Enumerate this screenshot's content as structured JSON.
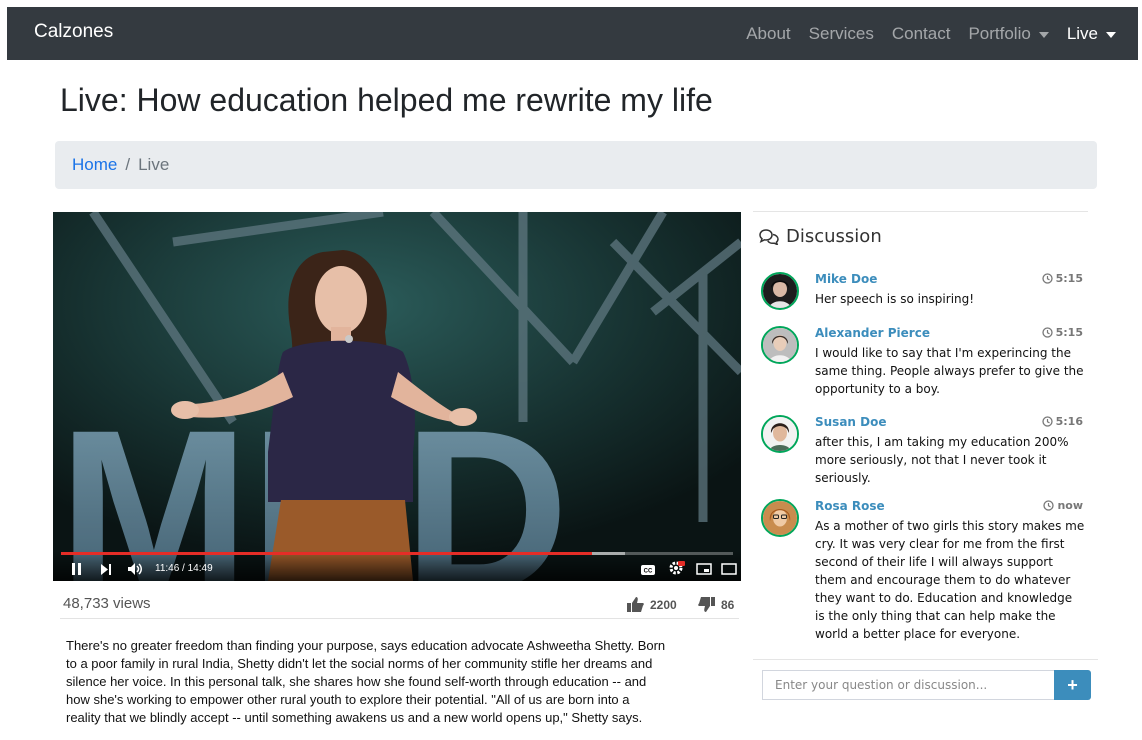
{
  "navbar": {
    "brand": "Calzones",
    "links": [
      {
        "label": "About",
        "active": false,
        "dropdown": false
      },
      {
        "label": "Services",
        "active": false,
        "dropdown": false
      },
      {
        "label": "Contact",
        "active": false,
        "dropdown": false
      },
      {
        "label": "Portfolio",
        "active": false,
        "dropdown": true
      },
      {
        "label": "Live",
        "active": true,
        "dropdown": true
      }
    ]
  },
  "page": {
    "title": "Live: How education helped me rewrite my life"
  },
  "breadcrumb": {
    "home": "Home",
    "separator": "/",
    "current": "Live"
  },
  "video": {
    "current_time": "11:46",
    "duration": "14:49",
    "time_display": "11:46 / 14:49",
    "progress_fraction": 0.79,
    "buffered_fraction": 0.84,
    "backdrop_letters": "MED",
    "views": "48,733 views",
    "likes": "2200",
    "dislikes": "86",
    "description": "There's no greater freedom than finding your purpose, says education advocate Ashweetha Shetty. Born to a poor family in rural India, Shetty didn't let the social norms of her community stifle her dreams and silence her voice. In this personal talk, she shares how she found self-worth through education -- and how she's working to empower other rural youth to explore their potential. \"All of us are born into a reality that we blindly accept -- until something awakens us and a new world opens up,\" Shetty says."
  },
  "discussion": {
    "title": "Discussion",
    "messages": [
      {
        "name": "Mike Doe",
        "time": "5:15",
        "text": "Her speech is so inspiring!"
      },
      {
        "name": "Alexander Pierce",
        "time": "5:15",
        "text": "I would like to say that I'm experincing the same thing. People always prefer to give the opportunity to a boy."
      },
      {
        "name": "Susan Doe",
        "time": "5:16",
        "text": "after this, I am taking my education 200% more seriously, not that I never took it seriously."
      },
      {
        "name": "Rosa Rose",
        "time": "now",
        "text": "As a mother of two girls this story makes me cry. It was very clear for me from the first second of their life I will always support them and encourage them to do whatever they want to do. Education and knowledge is the only thing that can help make the world a better place for everyone."
      }
    ],
    "input_placeholder": "Enter your question or discussion...",
    "submit_label": "+"
  },
  "colors": {
    "navbar_bg": "#343a40",
    "link": "#1a73e8",
    "chat_name": "#3c8dbc",
    "avatar_border": "#00a65a",
    "submit_bg": "#3c8dbc",
    "progress_red": "#e52d27"
  }
}
